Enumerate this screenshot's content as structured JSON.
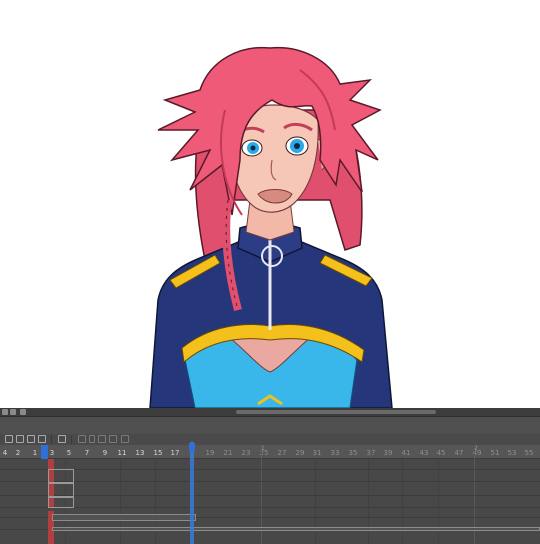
{
  "colors": {
    "playhead": "#2f6fd6",
    "keyframe": "#b04040",
    "timeline_bg": "#4a4a4a"
  },
  "timeline": {
    "scroll_icons": [
      "eye-icon",
      "lock-icon",
      "settings-icon"
    ],
    "toolbar_icons": [
      "new-layer-icon",
      "new-folder-icon",
      "duplicate-icon",
      "layer-settings-icon",
      "film-icon",
      "onion-skin-icon",
      "chevron-down-icon",
      "drawing-icon",
      "cel-icon",
      "pencil-icon"
    ],
    "ruler": {
      "labels": [
        "4",
        "2",
        "1",
        "3",
        "5",
        "7",
        "9",
        "11",
        "13",
        "15",
        "17",
        "19",
        "21",
        "23",
        "25",
        "27",
        "29",
        "31",
        "33",
        "35",
        "37",
        "39",
        "41",
        "43",
        "45",
        "47",
        "49",
        "51",
        "53",
        "55"
      ],
      "dim_labels": [
        "17",
        "19",
        "21",
        "23",
        "25",
        "27",
        "29",
        "31",
        "33",
        "35",
        "37",
        "39",
        "41",
        "43",
        "45",
        "47",
        "49",
        "51",
        "53",
        "55"
      ],
      "second_markers": [
        "1",
        "2"
      ]
    }
  }
}
